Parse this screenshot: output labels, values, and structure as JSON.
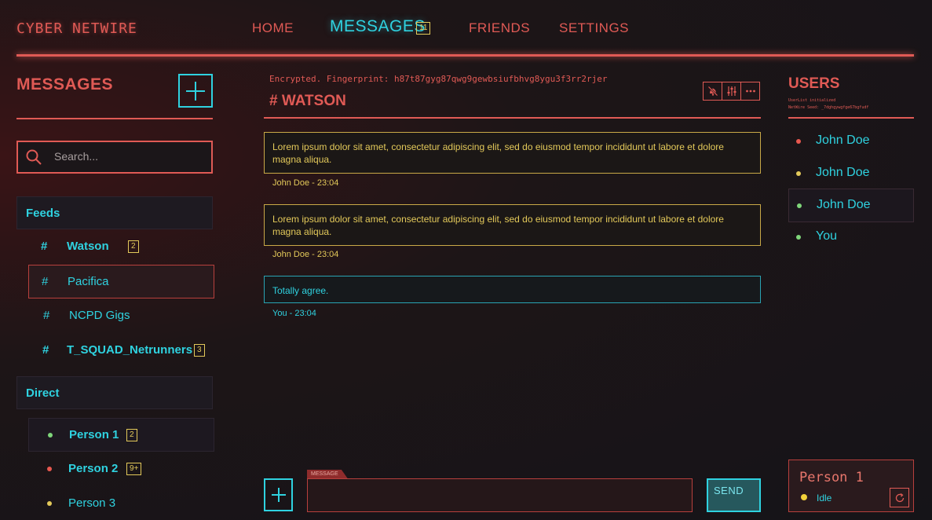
{
  "app": {
    "brand": "CYBER NETWIRE"
  },
  "nav": {
    "home": "HOME",
    "messages": "MESSAGES",
    "messages_badge": "11",
    "friends": "FRIENDS",
    "settings": "SETTINGS"
  },
  "sidebar": {
    "title": "MESSAGES",
    "add_icon": "plus-icon",
    "search_placeholder": "Search...",
    "feeds_label": "Feeds",
    "direct_label": "Direct",
    "feeds": [
      {
        "name": "Watson",
        "badge": "2"
      },
      {
        "name": "Pacifica",
        "badge": ""
      },
      {
        "name": "NCPD Gigs",
        "badge": ""
      },
      {
        "name": "T_SQUAD_Netrunners",
        "badge": "3"
      }
    ],
    "direct": [
      {
        "name": "Person 1",
        "badge": "2",
        "status_color": "#7fd67a"
      },
      {
        "name": "Person 2",
        "badge": "9+",
        "status_color": "#e8584f"
      },
      {
        "name": "Person 3",
        "badge": "",
        "status_color": "#e3c95a"
      }
    ]
  },
  "channel": {
    "fingerprint": "Encrypted. Fingerprint: h87t87gyg87qwg9gewbsiufbhvg8ygu3f3rr2rjer",
    "title": "# WATSON",
    "tools": [
      "bell-off-icon",
      "sliders-icon",
      "more-icon"
    ]
  },
  "messages": [
    {
      "text": "Lorem ipsum dolor sit amet, consectetur adipiscing elit, sed do eiusmod tempor incididunt ut labore et dolore magna aliqua.",
      "meta": "John Doe - 23:04",
      "own": false
    },
    {
      "text": "Lorem ipsum dolor sit amet, consectetur adipiscing elit, sed do eiusmod tempor incididunt ut labore et dolore magna aliqua.",
      "meta": "John Doe - 23:04",
      "own": false
    },
    {
      "text": "Totally agree.",
      "meta": "You - 23:04",
      "own": true
    }
  ],
  "composer": {
    "tag": "MESSAGE",
    "send_label": "SEND"
  },
  "users": {
    "title": "USERS",
    "sub_line1": "UserList initialized",
    "sub_line2": "NetWire Seed: _7dghgywgfge67bgfudf",
    "list": [
      {
        "name": "John Doe",
        "status_color": "#e8584f"
      },
      {
        "name": "John Doe",
        "status_color": "#e3c95a"
      },
      {
        "name": "John Doe",
        "status_color": "#7fd67a"
      },
      {
        "name": "You",
        "status_color": "#7fd67a"
      }
    ]
  },
  "profile": {
    "name": "Person 1",
    "status": "Idle",
    "status_color": "#f2d13a"
  }
}
